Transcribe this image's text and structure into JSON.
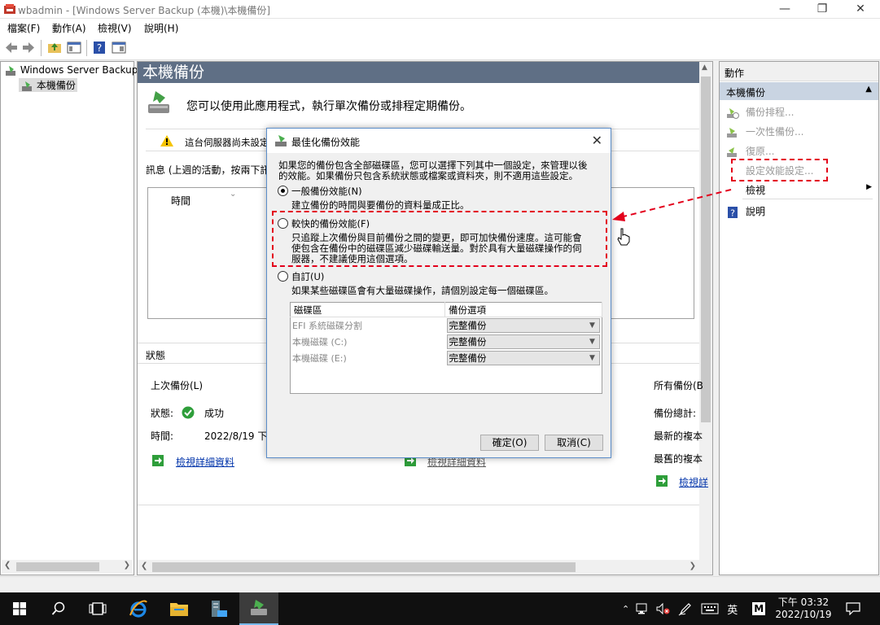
{
  "window": {
    "title": "wbadmin - [Windows Server Backup (本機)\\本機備份]",
    "menu": [
      "檔案(F)",
      "動作(A)",
      "檢視(V)",
      "說明(H)"
    ]
  },
  "tree": {
    "root": "Windows Server Backup",
    "child": "本機備份"
  },
  "center": {
    "header": "本機備份",
    "intro": "您可以使用此應用程式，執行單次備份或排程定期備份。",
    "warning": "這台伺服器尚未設定",
    "messages_label": "訊息 (上週的活動，按兩下訊",
    "col_time": "時間",
    "status_label": "狀態",
    "last_backup": {
      "title": "上次備份(L)",
      "status_key": "狀態:",
      "status_val": "成功",
      "time_key": "時間:",
      "time_val": "2022/8/19 下午",
      "link": "檢視詳細資料"
    },
    "next_backup_link": "檢視詳細資料",
    "all_backups": {
      "title": "所有備份(B",
      "total": "備份總計:",
      "newest": "最新的複本",
      "oldest": "最舊的複本",
      "link": "檢視詳"
    }
  },
  "actions": {
    "header": "動作",
    "section": "本機備份",
    "items": [
      "備份排程...",
      "一次性備份...",
      "復原...",
      "設定效能設定...",
      "檢視",
      "說明"
    ]
  },
  "dialog": {
    "title": "最佳化備份效能",
    "intro_line1": "如果您的備份包含全部磁碟區，您可以選擇下列其中一個設定，來管理以後",
    "intro_line2": "的效能。如果備份只包含系統狀態或檔案或資料夾，則不適用這些設定。",
    "opt1_label": "一般備份效能(N)",
    "opt1_desc": "建立備份的時間與要備份的資料量成正比。",
    "opt2_label": "較快的備份效能(F)",
    "opt2_desc1": "只追蹤上次備份與目前備份之間的變更，即可加快備份速度。這可能會",
    "opt2_desc2": "使包含在備份中的磁碟區減少磁碟輸送量。對於具有大量磁碟操作的伺",
    "opt2_desc3": "服器，不建議使用這個選項。",
    "opt3_label": "自訂(U)",
    "opt3_desc": "如果某些磁碟區會有大量磁碟操作，請個別設定每一個磁碟區。",
    "table_headers": [
      "磁碟區",
      "備份選項"
    ],
    "rows": [
      {
        "volume": "EFI 系統磁碟分割",
        "option": "完整備份"
      },
      {
        "volume": "本機磁碟 (C:)",
        "option": "完整備份"
      },
      {
        "volume": "本機磁碟 (E:)",
        "option": "完整備份"
      }
    ],
    "ok": "確定(O)",
    "cancel": "取消(C)"
  },
  "taskbar": {
    "ime": "英",
    "ime2": "M",
    "time": "下午 03:32",
    "date": "2022/10/19"
  }
}
